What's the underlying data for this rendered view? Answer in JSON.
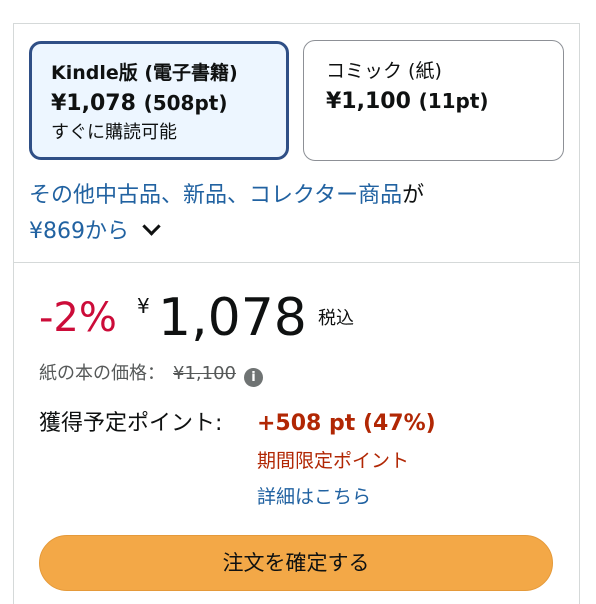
{
  "formats": {
    "kindle": {
      "name": "Kindle版 (電子書籍)",
      "price": "¥1,078",
      "points": "(508pt)",
      "note": "すぐに購読可能"
    },
    "comic": {
      "name": "コミック (紙)",
      "price": "¥1,100",
      "points": "(11pt)"
    }
  },
  "other_offers": {
    "link_text": "その他中古品、新品、コレクター商品",
    "suffix": "が",
    "price_text": "¥869から"
  },
  "price": {
    "discount": "-2%",
    "currency_symbol": "¥",
    "amount": "1,078",
    "tax_label": "税込"
  },
  "list_price": {
    "label": "紙の本の価格：",
    "value": "¥1,100",
    "info_glyph": "i"
  },
  "points": {
    "label": "獲得予定ポイント:",
    "value": "+508 pt (47%)",
    "limited_label": "期間限定ポイント",
    "details_link": "詳細はこちら"
  },
  "buy_button": {
    "label": "注文を確定する"
  },
  "colors": {
    "accent_blue": "#2162a1",
    "selected_border": "#2f4f86",
    "selected_bg": "#edf6ff",
    "discount_red": "#cc0c39",
    "points_red": "#b12704",
    "button_orange": "#f3a847"
  },
  "icons": {
    "expand": "chevron-down-icon",
    "info": "info-icon"
  }
}
